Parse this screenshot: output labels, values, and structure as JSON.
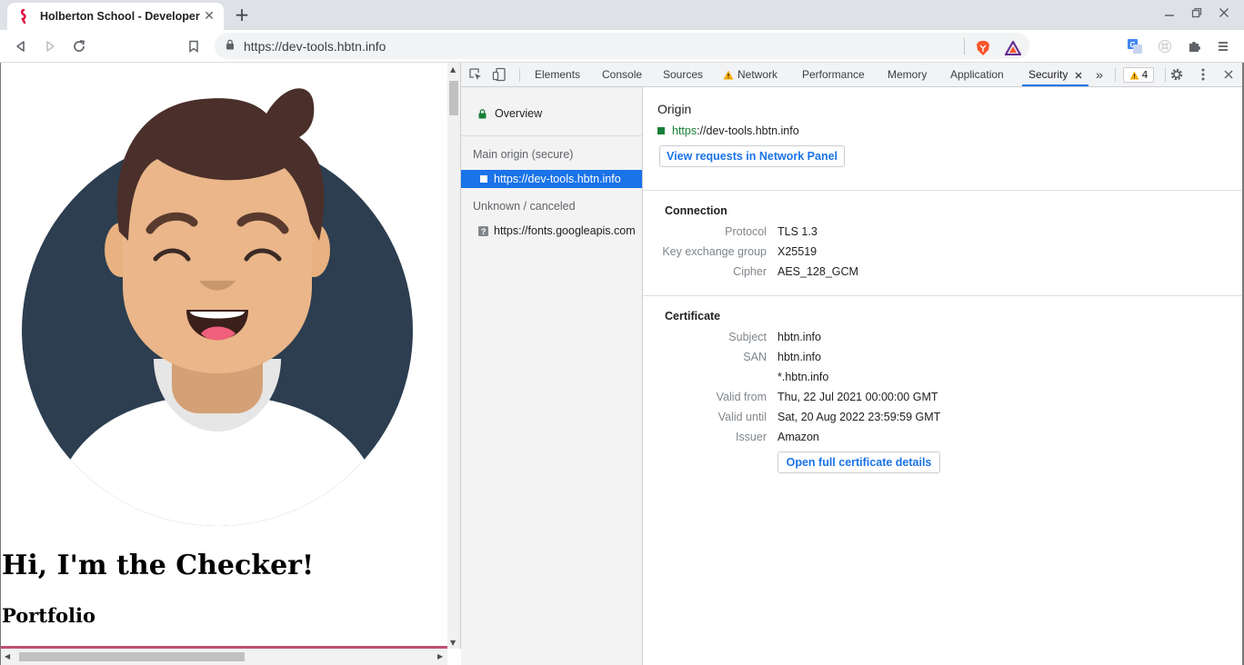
{
  "browser": {
    "tab_title": "Holberton School - Developer",
    "tab_close": "✕",
    "new_tab": "+",
    "url": "https://dev-tools.hbtn.info"
  },
  "page": {
    "heading": "Hi, I'm the Checker!",
    "subheading": "Portfolio"
  },
  "devtools": {
    "tabs": {
      "elements": "Elements",
      "console": "Console",
      "sources": "Sources",
      "network": "Network",
      "performance": "Performance",
      "memory": "Memory",
      "application": "Application",
      "security": "Security",
      "more": "»"
    },
    "warning_count": "4",
    "sidebar": {
      "overview": "Overview",
      "main_origin_heading": "Main origin (secure)",
      "main_origin_url": "https://dev-tools.hbtn.info",
      "unknown_heading": "Unknown / canceled",
      "unknown_url": "https://fonts.googleapis.com"
    },
    "security": {
      "origin_title": "Origin",
      "origin_url": "https://dev-tools.hbtn.info",
      "view_requests_button": "View requests in Network Panel",
      "connection": {
        "heading": "Connection",
        "rows": [
          {
            "key": "Protocol",
            "value": "TLS 1.3"
          },
          {
            "key": "Key exchange group",
            "value": "X25519"
          },
          {
            "key": "Cipher",
            "value": "AES_128_GCM"
          }
        ]
      },
      "certificate": {
        "heading": "Certificate",
        "rows": [
          {
            "key": "Subject",
            "value": "hbtn.info"
          },
          {
            "key": "SAN",
            "value": "hbtn.info"
          },
          {
            "key": "",
            "value": "*.hbtn.info"
          },
          {
            "key": "Valid from",
            "value": "Thu, 22 Jul 2021 00:00:00 GMT"
          },
          {
            "key": "Valid until",
            "value": "Sat, 20 Aug 2022 23:59:59 GMT"
          },
          {
            "key": "Issuer",
            "value": "Amazon"
          }
        ],
        "open_details_button": "Open full certificate details"
      }
    }
  },
  "colors": {
    "accent": "#1a73e8",
    "secure_green": "#188038",
    "warning": "#f9ab00",
    "avatar_bg": "#2c3e50"
  }
}
